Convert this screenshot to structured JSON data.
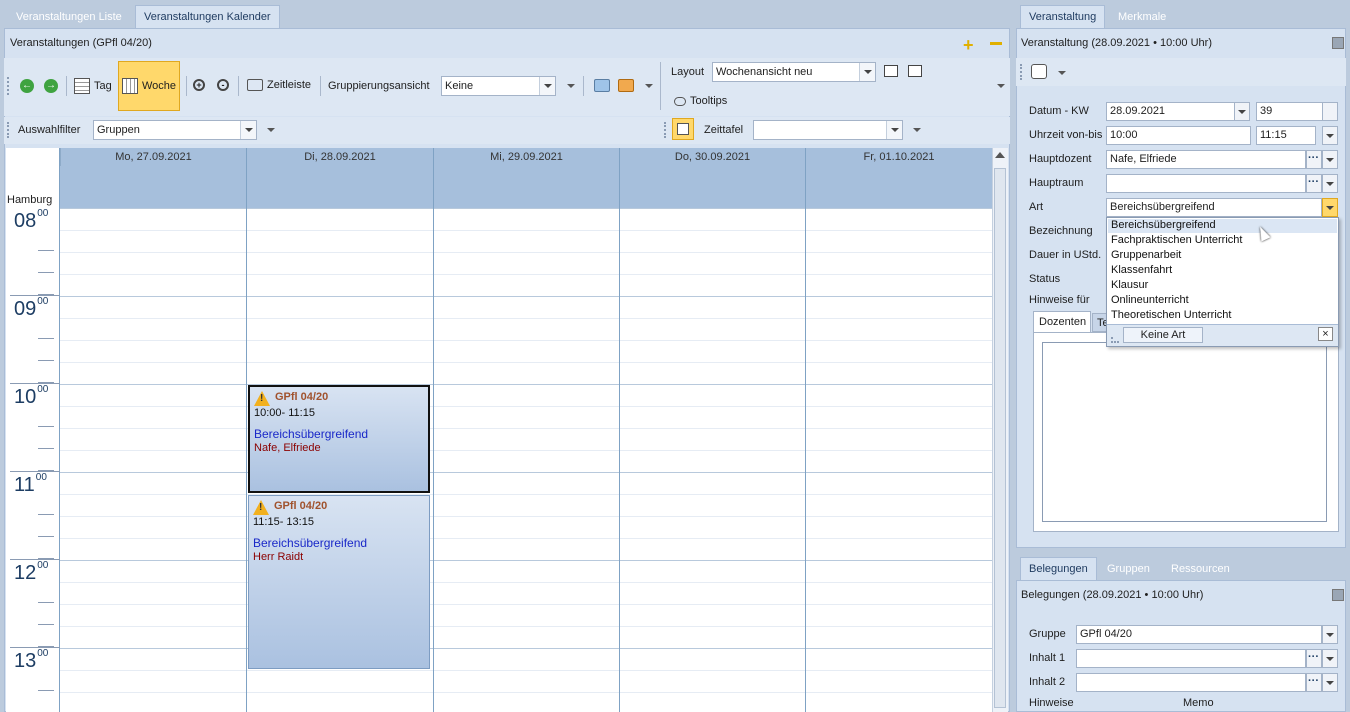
{
  "left_tabs": [
    "Veranstaltungen Liste",
    "Veranstaltungen Kalender"
  ],
  "right_tabs": [
    "Veranstaltung",
    "Merkmale"
  ],
  "left_panel_title": "Veranstaltungen (GPfl 04/20)",
  "toolbar": {
    "tag": "Tag",
    "woche": "Woche",
    "zeitleiste": "Zeitleiste",
    "gruppierungsansicht": "Gruppierungsansicht",
    "gruppierung_value": "Keine",
    "layout_label": "Layout",
    "layout_value": "Wochenansicht neu",
    "tooltips": "Tooltips",
    "auswahlfilter_label": "Auswahlfilter",
    "auswahlfilter_value": "Gruppen",
    "zeittafel_label": "Zeittafel",
    "zeittafel_value": ""
  },
  "calendar": {
    "location": "Hamburg",
    "days": [
      "Mo, 27.09.2021",
      "Di, 28.09.2021",
      "Mi, 29.09.2021",
      "Do, 30.09.2021",
      "Fr, 01.10.2021"
    ],
    "hours": [
      "08",
      "09",
      "10",
      "11",
      "12",
      "13"
    ],
    "minutes_sup": "00",
    "events": [
      {
        "title": "GPfl 04/20",
        "time": "10:00- 11:15",
        "art": "Bereichsübergreifend",
        "dozent": "Nafe, Elfriede"
      },
      {
        "title": "GPfl 04/20",
        "time": "11:15- 13:15",
        "art": "Bereichsübergreifend",
        "dozent": "Herr Raidt"
      }
    ]
  },
  "detail": {
    "title": "Veranstaltung (28.09.2021 • 10:00 Uhr)",
    "labels": {
      "datum_kw": "Datum - KW",
      "uhrzeit": "Uhrzeit von-bis",
      "hauptdozent": "Hauptdozent",
      "hauptraum": "Hauptraum",
      "art": "Art",
      "bezeichnung": "Bezeichnung",
      "dauer": "Dauer in UStd.",
      "status": "Status",
      "hinweise": "Hinweise für"
    },
    "values": {
      "datum": "28.09.2021",
      "kw": "39",
      "von": "10:00",
      "bis": "11:15",
      "hauptdozent": "Nafe, Elfriede",
      "hauptraum": "",
      "art": "Bereichsübergreifend"
    },
    "subtabs": [
      "Dozenten",
      "Te"
    ],
    "art_options": [
      "Bereichsübergreifend",
      "Fachpraktischen Unterricht",
      "Gruppenarbeit",
      "Klassenfahrt",
      "Klausur",
      "Onlineunterricht",
      "Theoretischen Unterricht"
    ],
    "keine_art": "Keine Art"
  },
  "bottom": {
    "tabs": [
      "Belegungen",
      "Gruppen",
      "Ressourcen"
    ],
    "title": "Belegungen (28.09.2021 • 10:00 Uhr)",
    "labels": {
      "gruppe": "Gruppe",
      "inhalt1": "Inhalt 1",
      "inhalt2": "Inhalt 2",
      "hinweise": "Hinweise",
      "memo": "Memo"
    },
    "values": {
      "gruppe": "GPfl 04/20",
      "inhalt1": "",
      "inhalt2": ""
    }
  }
}
